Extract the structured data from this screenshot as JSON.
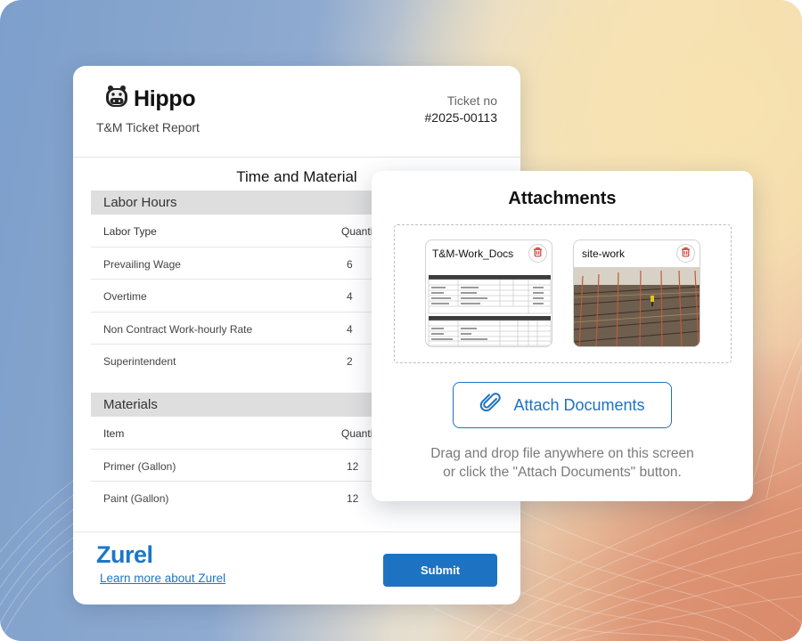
{
  "report": {
    "brand": "Hippo",
    "subtitle": "T&M Ticket Report",
    "ticket_label": "Ticket no",
    "ticket_number": "#2025-00113",
    "section_title": "Time and Material",
    "labor": {
      "heading": "Labor Hours",
      "columns": [
        "Labor Type",
        "Quanti"
      ],
      "rows": [
        {
          "name": "Prevailing Wage",
          "qty": "6"
        },
        {
          "name": "Overtime",
          "qty": "4"
        },
        {
          "name": "Non Contract Work-hourly Rate",
          "qty": "4"
        },
        {
          "name": "Superintendent",
          "qty": "2"
        }
      ]
    },
    "materials": {
      "heading": "Materials",
      "columns": [
        "Item",
        "Quanti"
      ],
      "rows": [
        {
          "name": "Primer (Gallon)",
          "qty": "12"
        },
        {
          "name": "Paint (Gallon)",
          "qty": "12"
        }
      ]
    },
    "footer": {
      "zurel_logo": "Zurel",
      "learn_more": "Learn more about Zurel",
      "submit_label": "Submit"
    }
  },
  "attachments": {
    "title": "Attachments",
    "files": [
      {
        "name": "T&M-Work_Docs",
        "kind": "document"
      },
      {
        "name": "site-work",
        "kind": "photo"
      }
    ],
    "attach_button_label": "Attach Documents",
    "hint_line1": "Drag and drop file anywhere on this screen",
    "hint_line2": "or click the \"Attach Documents\" button."
  },
  "colors": {
    "accent": "#1d73c2",
    "trash": "#d93a3a"
  },
  "icons": [
    "hippo-logo-icon",
    "paperclip-icon",
    "trash-icon"
  ]
}
